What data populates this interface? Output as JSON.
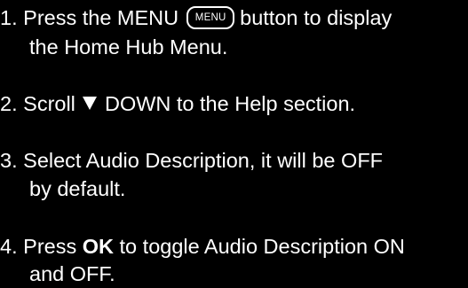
{
  "steps": [
    {
      "number": "1.",
      "line1_before": "Press the MENU",
      "key_label": "MENU",
      "line1_after": "button to display",
      "line2": "the Home Hub Menu."
    },
    {
      "number": "2.",
      "line1_before": "Scroll",
      "arrow_icon": "down-triangle-icon",
      "line1_after": "DOWN to the Help section."
    },
    {
      "number": "3.",
      "line1": "Select Audio Description, it will be OFF",
      "line2": "by default."
    },
    {
      "number": "4.",
      "line1_before": "Press",
      "bold": "OK",
      "line1_after": "to toggle Audio Description ON",
      "line2": "and OFF."
    }
  ]
}
